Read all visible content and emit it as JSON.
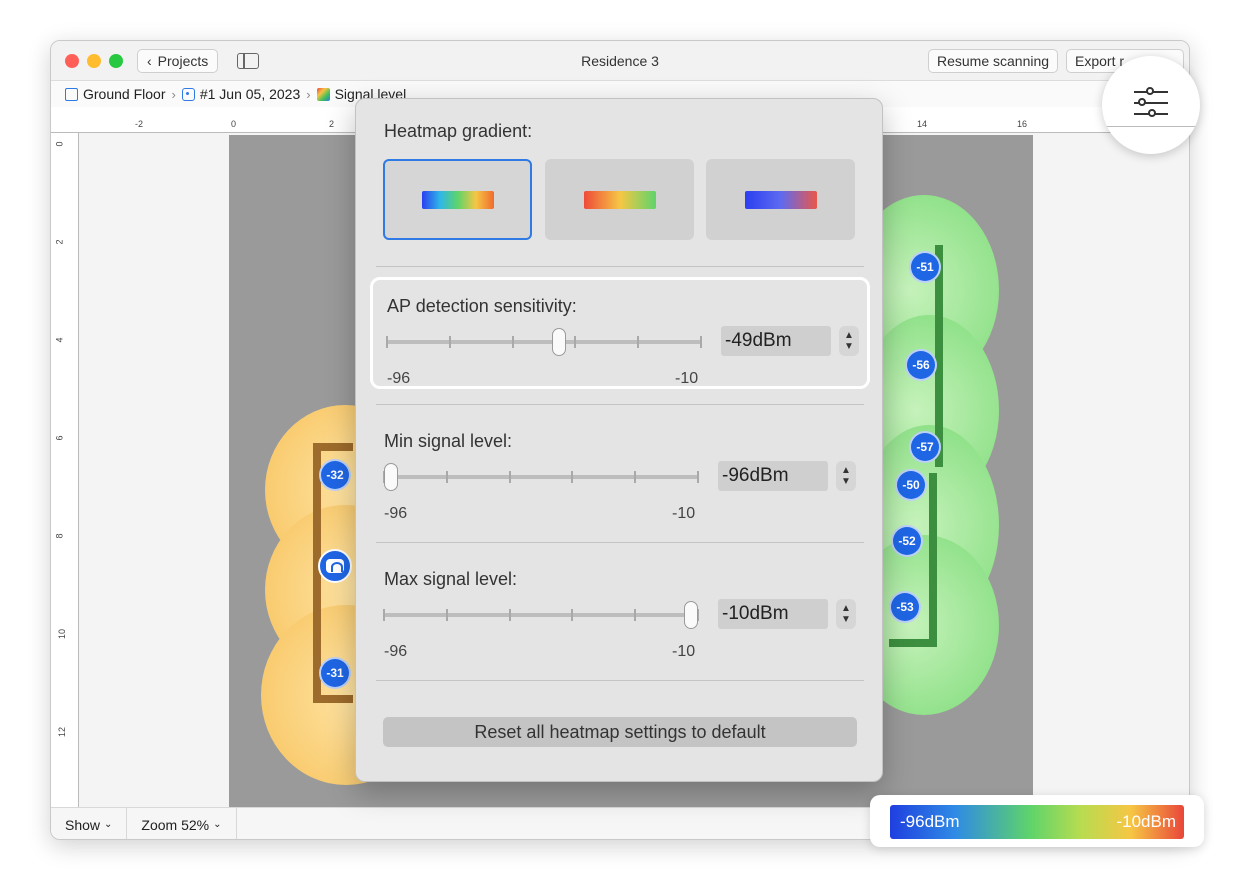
{
  "window": {
    "title": "Residence 3",
    "back_label": "Projects",
    "resume_label": "Resume scanning",
    "export_label": "Export r"
  },
  "breadcrumb": {
    "floor": "Ground Floor",
    "scan": "#1 Jun 05, 2023",
    "view": "Signal level"
  },
  "ruler": {
    "top_ticks": [
      "-2",
      "0",
      "2",
      "14",
      "16"
    ],
    "left_ticks": [
      "0",
      "2",
      "4",
      "6",
      "8",
      "10",
      "12"
    ]
  },
  "markers": [
    "-32",
    "-31",
    "-51",
    "-56",
    "-57",
    "-50",
    "-52",
    "-53"
  ],
  "panel": {
    "title": "Heatmap gradient:",
    "gradients": [
      {
        "colors": [
          "#2a3ff0",
          "#2fb6e8",
          "#5fd46a",
          "#f6c644",
          "#ef6b2e"
        ],
        "selected": true
      },
      {
        "colors": [
          "#ef4a3a",
          "#f6c644",
          "#5fd46a"
        ],
        "selected": false
      },
      {
        "colors": [
          "#2a3ff0",
          "#5f6af0",
          "#e9574a"
        ],
        "selected": false
      }
    ],
    "sections": [
      {
        "label": "AP detection sensitivity:",
        "value": "-49dBm",
        "min": "-96",
        "max": "-10",
        "level": 0.55,
        "highlight": true
      },
      {
        "label": "Min signal level:",
        "value": "-96dBm",
        "min": "-96",
        "max": "-10",
        "level": 0.0,
        "highlight": false
      },
      {
        "label": "Max signal level:",
        "value": "-10dBm",
        "min": "-96",
        "max": "-10",
        "level": 1.0,
        "highlight": false
      }
    ],
    "reset_label": "Reset all heatmap settings to default"
  },
  "bottombar": {
    "show_label": "Show",
    "zoom_label": "Zoom 52%"
  },
  "legend": {
    "min": "-96dBm",
    "max": "-10dBm"
  },
  "colors": {
    "accent": "#2f7ae5",
    "marker": "#1f66e5"
  }
}
